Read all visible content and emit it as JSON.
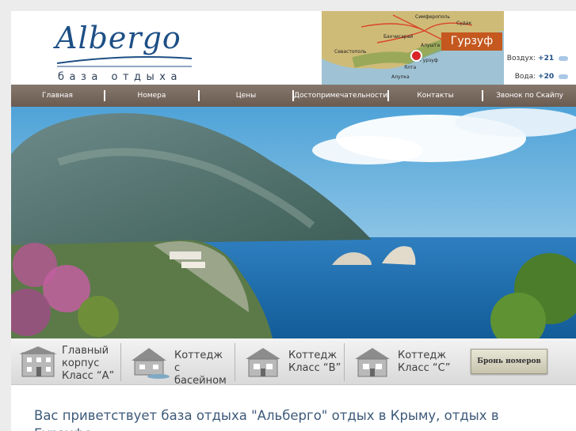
{
  "brand": {
    "logo_text": "Albergo",
    "subtitle": "база отдыха"
  },
  "map": {
    "labels": [
      "Симферополь",
      "Судак",
      "Бахчисарай",
      "Алушта",
      "Севастополь",
      "Гурзуф",
      "Ялта",
      "Алупка"
    ],
    "location": "Гурзуф"
  },
  "weather": {
    "air_label": "Воздух:",
    "air_value": "+21",
    "water_label": "Вода:",
    "water_value": "+20"
  },
  "nav": {
    "items": [
      "Главная",
      "Номера",
      "Цены",
      "Достопримечательности",
      "Контакты",
      "Звонок по Скайпу"
    ]
  },
  "categories": [
    {
      "lines": [
        "Главный",
        "корпус",
        "Класс “А”"
      ]
    },
    {
      "lines": [
        "Коттедж",
        "с басейном"
      ]
    },
    {
      "lines": [
        "Коттедж",
        "Класс “В”"
      ]
    },
    {
      "lines": [
        "Коттедж",
        "Класс “С”"
      ]
    }
  ],
  "booking_button": "Бронь номеров",
  "welcome_text": "Вас приветствует база отдыха \"Альберго\" отдых в Крыму, отдых в Гурзуфе",
  "colors": {
    "nav_bg": "#7a6b61",
    "accent": "#c4581f",
    "logo": "#1d4f86"
  }
}
